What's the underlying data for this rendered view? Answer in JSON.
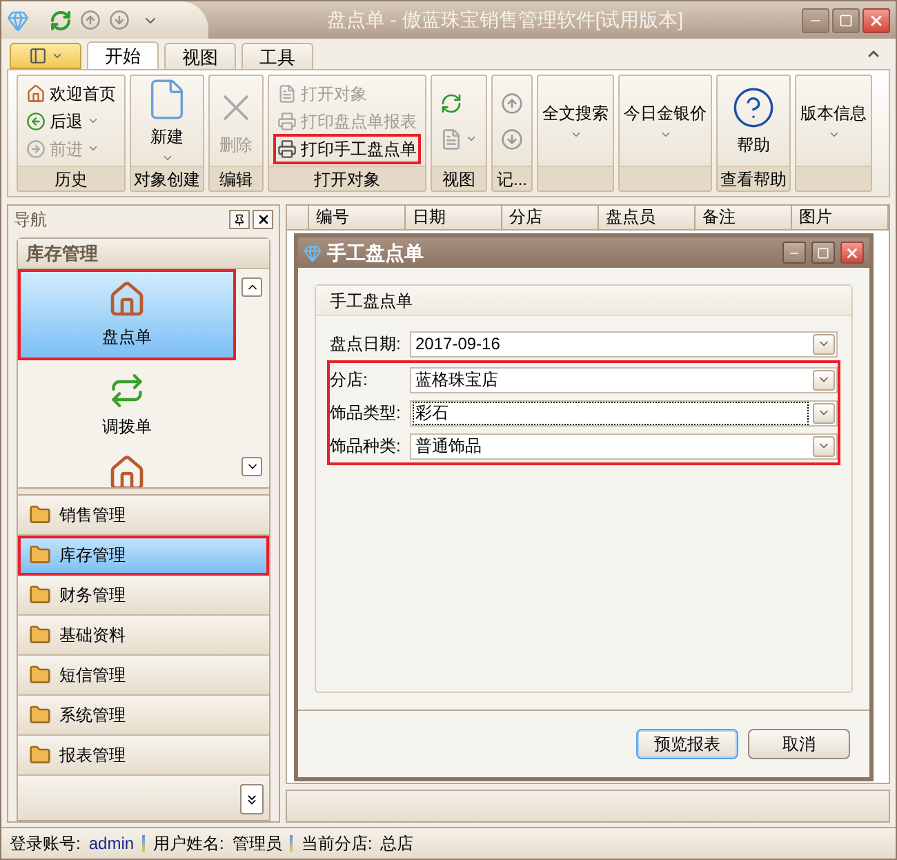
{
  "window": {
    "title": "盘点单 - 傲蓝珠宝销售管理软件[试用版本]"
  },
  "ribbon": {
    "tabs": [
      {
        "label": "开始",
        "selected": true
      },
      {
        "label": "视图",
        "selected": false
      },
      {
        "label": "工具",
        "selected": false
      }
    ],
    "groups": [
      {
        "title": "历史",
        "items": [
          {
            "kind": "small",
            "label": "欢迎首页",
            "disabled": false,
            "dropdown": false,
            "highlighted": false
          },
          {
            "kind": "small",
            "label": "后退",
            "disabled": false,
            "dropdown": true,
            "highlighted": false
          },
          {
            "kind": "small",
            "label": "前进",
            "disabled": true,
            "dropdown": true,
            "highlighted": false
          }
        ]
      },
      {
        "title": "对象创建",
        "items": [
          {
            "kind": "large",
            "label": "新建",
            "disabled": false,
            "dropdown": true,
            "highlighted": false
          }
        ]
      },
      {
        "title": "编辑",
        "items": [
          {
            "kind": "large",
            "label": "删除",
            "disabled": true,
            "dropdown": false,
            "highlighted": false
          }
        ]
      },
      {
        "title": "打开对象",
        "items": [
          {
            "kind": "small",
            "label": "打开对象",
            "disabled": true,
            "dropdown": false,
            "highlighted": false
          },
          {
            "kind": "small",
            "label": "打印盘点单报表",
            "disabled": true,
            "dropdown": false,
            "highlighted": false
          },
          {
            "kind": "small",
            "label": "打印手工盘点单",
            "disabled": false,
            "dropdown": false,
            "highlighted": true
          }
        ]
      },
      {
        "title": "视图",
        "items": [
          {
            "kind": "icon",
            "disabled": false,
            "dropdown": false,
            "highlighted": false
          },
          {
            "kind": "icon",
            "disabled": true,
            "dropdown": true,
            "highlighted": false
          }
        ]
      },
      {
        "title": "记...",
        "items": [
          {
            "kind": "icon",
            "disabled": false,
            "dropdown": false,
            "highlighted": false
          },
          {
            "kind": "icon",
            "disabled": false,
            "dropdown": false,
            "highlighted": false
          }
        ]
      },
      {
        "items": [
          {
            "kind": "large",
            "label": "全文搜索",
            "disabled": false,
            "dropdown": true,
            "highlighted": false
          }
        ]
      },
      {
        "items": [
          {
            "kind": "large",
            "label": "今日金银价",
            "disabled": false,
            "dropdown": true,
            "highlighted": false
          }
        ]
      },
      {
        "title": "查看帮助",
        "items": [
          {
            "kind": "large",
            "label": "帮助",
            "disabled": false,
            "dropdown": false,
            "highlighted": false
          }
        ]
      },
      {
        "items": [
          {
            "kind": "large",
            "label": "版本信息",
            "disabled": false,
            "dropdown": true,
            "highlighted": false
          }
        ]
      }
    ]
  },
  "navigation": {
    "title": "导航",
    "pane_title": "库存管理",
    "items": [
      {
        "label": "盘点单",
        "selected": true,
        "highlighted": true
      },
      {
        "label": "调拨单",
        "selected": false,
        "highlighted": false
      }
    ],
    "groups": [
      {
        "label": "销售管理",
        "selected": false,
        "highlighted": false
      },
      {
        "label": "库存管理",
        "selected": true,
        "highlighted": true
      },
      {
        "label": "财务管理",
        "selected": false,
        "highlighted": false
      },
      {
        "label": "基础资料",
        "selected": false,
        "highlighted": false
      },
      {
        "label": "短信管理",
        "selected": false,
        "highlighted": false
      },
      {
        "label": "系统管理",
        "selected": false,
        "highlighted": false
      },
      {
        "label": "报表管理",
        "selected": false,
        "highlighted": false
      }
    ]
  },
  "table": {
    "columns": [
      "编号",
      "日期",
      "分店",
      "盘点员",
      "备注",
      "图片"
    ]
  },
  "dialog": {
    "title": "手工盘点单",
    "group_title": "手工盘点单",
    "fields": [
      {
        "label": "盘点日期:",
        "value": "2017-09-16",
        "focused": false,
        "highlighted": false
      },
      {
        "label": "分店:",
        "value": "蓝格珠宝店",
        "focused": false,
        "highlighted": true
      },
      {
        "label": "饰品类型:",
        "value": "彩石",
        "focused": true,
        "highlighted": true
      },
      {
        "label": "饰品种类:",
        "value": "普通饰品",
        "focused": false,
        "highlighted": true
      }
    ],
    "buttons": [
      {
        "label": "预览报表",
        "default": true
      },
      {
        "label": "取消",
        "default": false
      }
    ]
  },
  "status_bar": [
    {
      "label": "登录账号:",
      "value": "admin"
    },
    {
      "label": "用户姓名:",
      "value": "管理员"
    },
    {
      "label": "当前分店:",
      "value": "总店"
    }
  ]
}
